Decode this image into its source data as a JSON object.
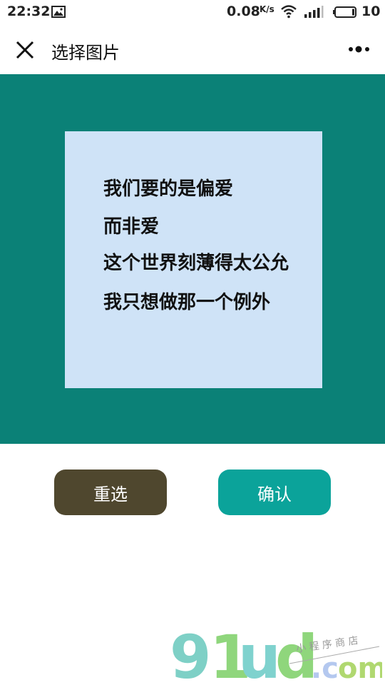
{
  "status_bar": {
    "time": "22:32",
    "net_speed": "0.08",
    "net_speed_unit": "K/s",
    "battery": "10"
  },
  "nav": {
    "title": "选择图片",
    "close_icon": "close-icon",
    "more_icon": "more-dots-icon"
  },
  "crop": {
    "background_color": "#0b8177",
    "image_color": "#cfe3f7",
    "lines": [
      "我们要的是偏爱",
      "而非爱",
      "这个世界刻薄得太公允",
      "我只想做那一个例外"
    ]
  },
  "buttons": {
    "reselect": "重选",
    "confirm": "确认",
    "reselect_color": "#4f472e",
    "confirm_color": "#0ba39a"
  }
}
